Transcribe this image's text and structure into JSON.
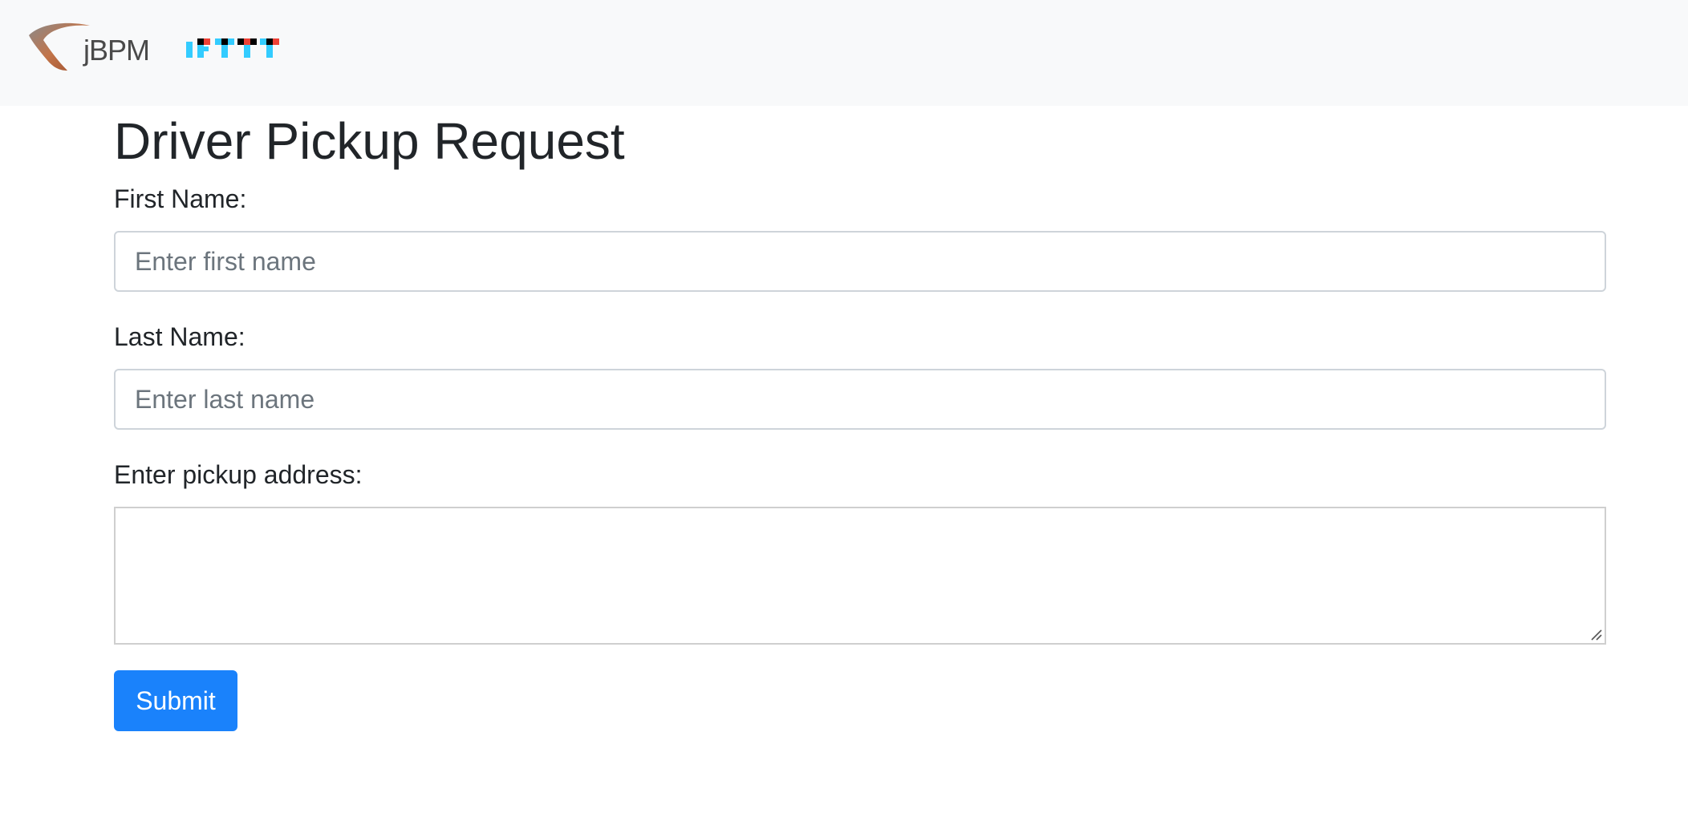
{
  "navbar": {
    "jbpm_logo_text": "jBPM",
    "ifttt_logo_text": "IFTTT"
  },
  "form": {
    "title": "Driver Pickup Request",
    "first_name": {
      "label": "First Name:",
      "placeholder": "Enter first name",
      "value": ""
    },
    "last_name": {
      "label": "Last Name:",
      "placeholder": "Enter last name",
      "value": ""
    },
    "address": {
      "label": "Enter pickup address:",
      "value": ""
    },
    "submit_label": "Submit"
  },
  "colors": {
    "navbar_bg": "#f8f9fa",
    "primary_button": "#1a82fb",
    "ifttt_blue": "#33ccff",
    "ifttt_red": "#ee4035",
    "jbpm_arc": "#b5603a"
  },
  "icons": {
    "jbpm_logo": "jbpm-arc-logo",
    "ifttt_logo": "ifttt-pixel-logo",
    "resize_handle": "textarea-resize-grip"
  }
}
